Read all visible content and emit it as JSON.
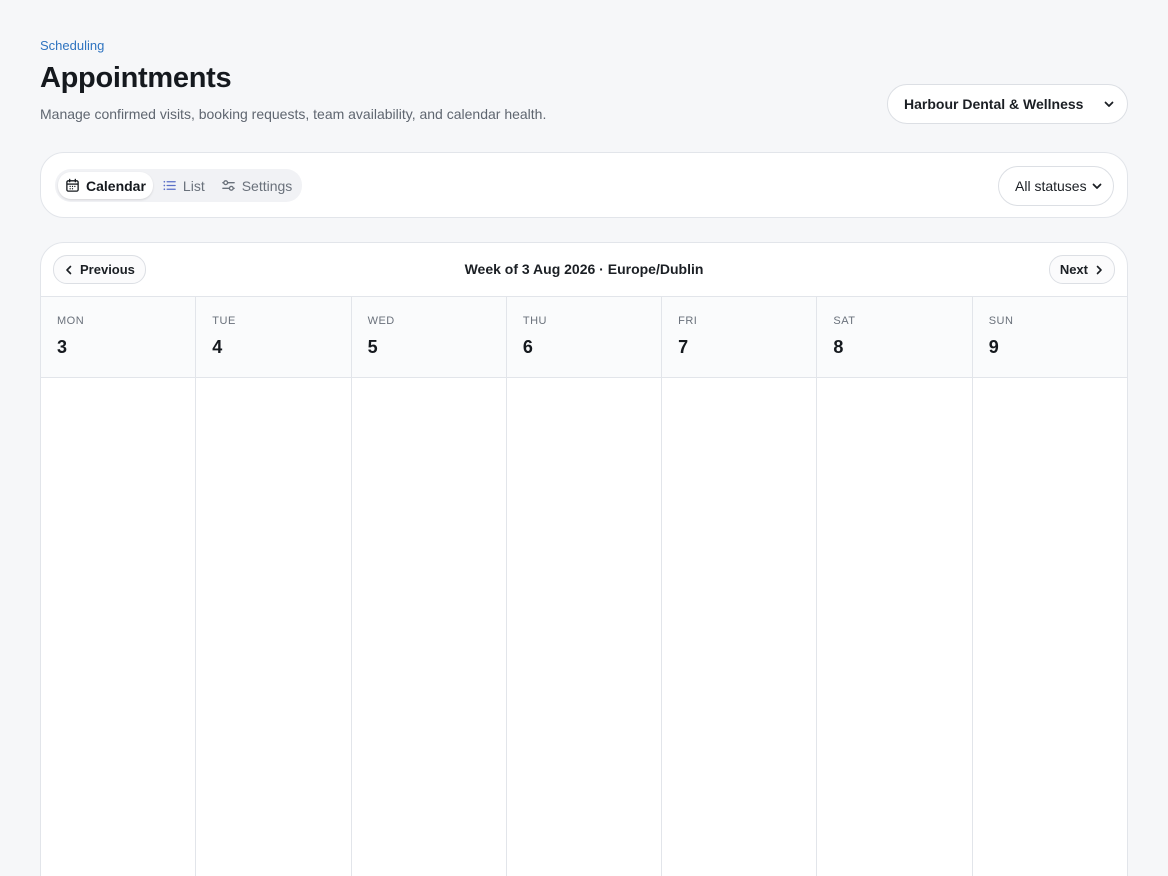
{
  "header": {
    "eyebrow": "Scheduling",
    "title": "Appointments",
    "subtitle": "Manage confirmed visits, booking requests, team availability, and calendar health."
  },
  "org_select": {
    "value": "Harbour Dental & Wellness"
  },
  "toolbar": {
    "tabs": [
      {
        "label": "Calendar",
        "icon": "calendar-icon",
        "active": true
      },
      {
        "label": "List",
        "icon": "list-icon",
        "active": false
      },
      {
        "label": "Settings",
        "icon": "sliders-icon",
        "active": false
      }
    ],
    "status_filter": {
      "value": "All statuses"
    }
  },
  "calendar": {
    "prev_label": "Previous",
    "next_label": "Next",
    "week_title": "Week of 3 Aug 2026 · Europe/Dublin",
    "days": [
      {
        "dow": "MON",
        "num": "3"
      },
      {
        "dow": "TUE",
        "num": "4"
      },
      {
        "dow": "WED",
        "num": "5"
      },
      {
        "dow": "THU",
        "num": "6"
      },
      {
        "dow": "FRI",
        "num": "7"
      },
      {
        "dow": "SAT",
        "num": "8"
      },
      {
        "dow": "SUN",
        "num": "9"
      }
    ]
  },
  "colors": {
    "accent": "#2f74c0",
    "background": "#f6f7f9",
    "border": "#e2e5ea"
  }
}
